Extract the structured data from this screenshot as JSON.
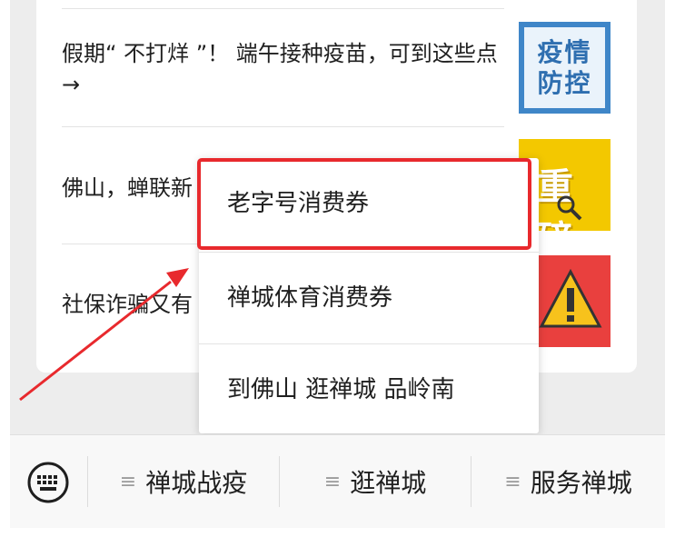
{
  "news": [
    {
      "title": "假期“ 不打烊 ”！ 端午接种疫苗，可到这些点 →",
      "thumb_text": [
        "疫情",
        "防控"
      ]
    },
    {
      "title": "佛山，蝉联新",
      "thumb_text": "重磅"
    },
    {
      "title": "社保诈骗又有",
      "thumb_text": ""
    }
  ],
  "popup_menu": {
    "items": [
      "老字号消费券",
      "禅城体育消费券",
      "到佛山 逛禅城 品岭南"
    ],
    "highlighted_index": 0
  },
  "bottom_menu": {
    "keyboard_icon": "keyboard-icon",
    "items": [
      "禅城战疫",
      "逛禅城",
      "服务禅城"
    ],
    "item_icon": "≡"
  },
  "colors": {
    "highlight_border": "#e8292d",
    "arrow": "#e8292d"
  }
}
